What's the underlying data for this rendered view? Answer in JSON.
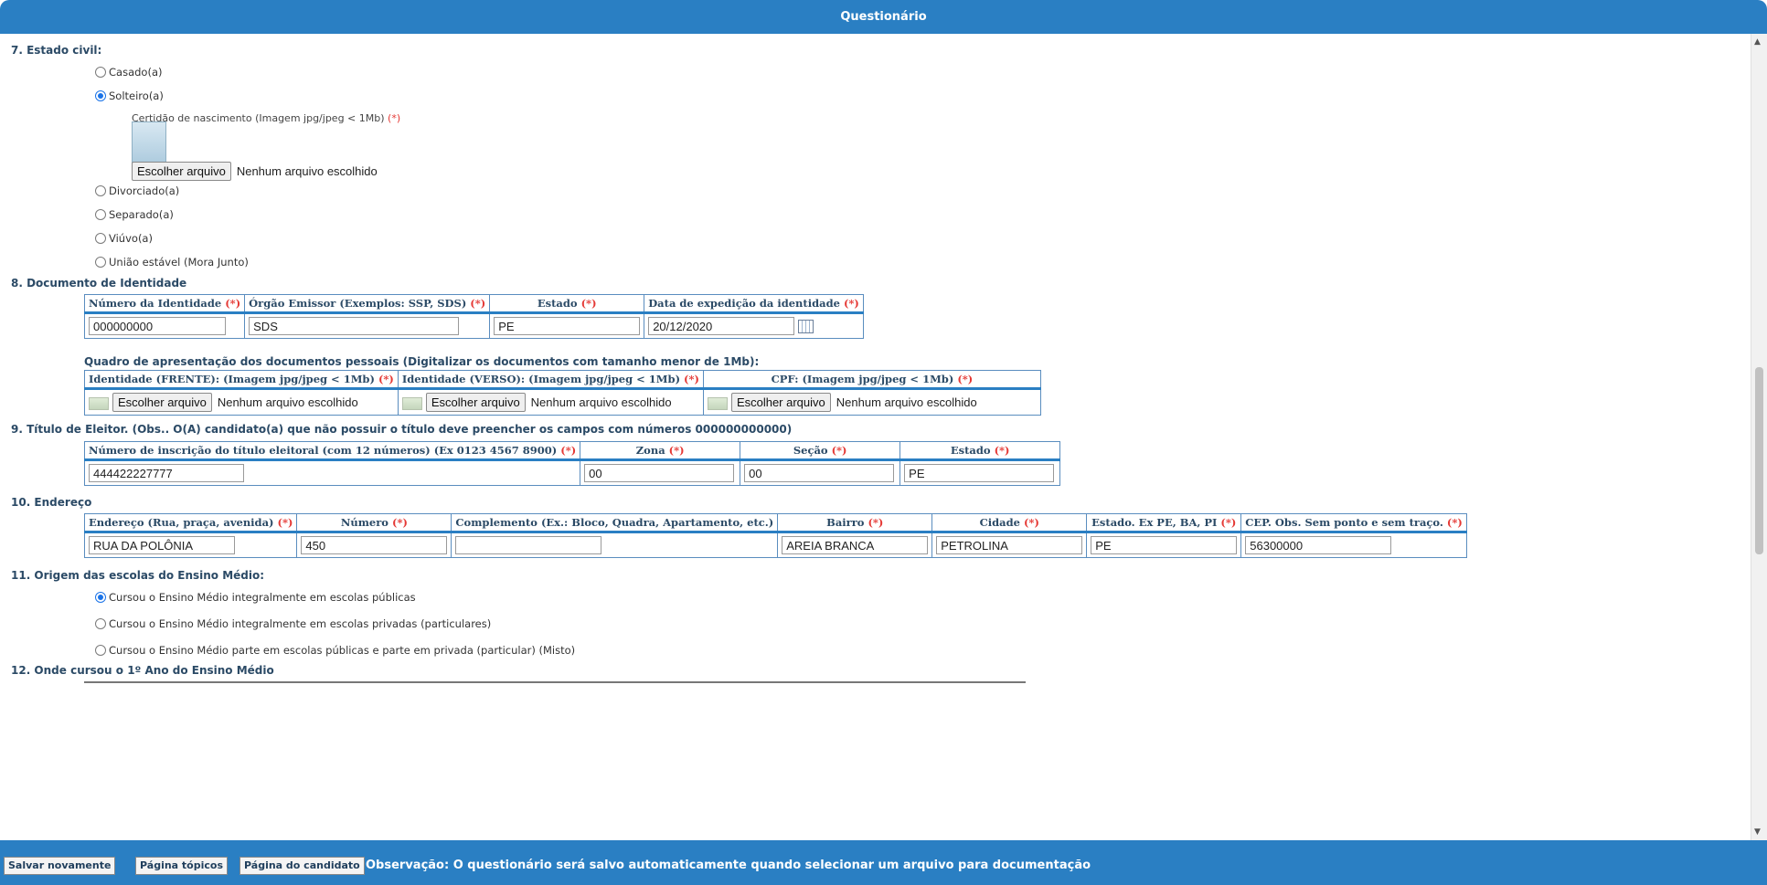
{
  "header": {
    "title": "Questionário"
  },
  "q7": {
    "title": "7. Estado civil:",
    "options": [
      "Casado(a)",
      "Solteiro(a)",
      "Divorciado(a)",
      "Separado(a)",
      "Viúvo(a)",
      "União estável (Mora Junto)"
    ],
    "selected": "Solteiro(a)",
    "attachment_label": "Certidão de nascimento (Imagem jpg/jpeg < 1Mb)",
    "required_mark": "(*)",
    "file_button": "Escolher arquivo",
    "file_status": "Nenhum arquivo escolhido"
  },
  "q8": {
    "title": "8. Documento de Identidade",
    "headers": [
      "Número da Identidade",
      "Órgão Emissor (Exemplos: SSP, SDS)",
      "Estado",
      "Data de expedição da identidade"
    ],
    "values": [
      "000000000",
      "SDS",
      "PE",
      "20/12/2020"
    ],
    "docs_caption": "Quadro de apresentação dos documentos pessoais (Digitalizar os documentos com tamanho menor de 1Mb):",
    "docs_headers": [
      "Identidade (FRENTE): (Imagem jpg/jpeg < 1Mb)",
      "Identidade (VERSO): (Imagem jpg/jpeg < 1Mb)",
      "CPF: (Imagem jpg/jpeg < 1Mb)"
    ]
  },
  "q9": {
    "title": "9. Título de Eleitor. (Obs.. O(A) candidato(a) que não possuir o título deve preencher os campos com números 000000000000)",
    "headers": [
      "Número de inscrição do título eleitoral (com 12 números) (Ex 0123 4567 8900)",
      "Zona",
      "Seção",
      "Estado"
    ],
    "values": [
      "444422227777",
      "00",
      "00",
      "PE"
    ]
  },
  "q10": {
    "title": "10. Endereço",
    "headers": [
      "Endereço (Rua, praça, avenida)",
      "Número",
      "Complemento (Ex.: Bloco, Quadra, Apartamento, etc.)",
      "Bairro",
      "Cidade",
      "Estado. Ex PE, BA, PI",
      "CEP. Obs. Sem ponto e sem traço."
    ],
    "values": [
      "RUA DA POLÔNIA",
      "450",
      "",
      "AREIA BRANCA",
      "PETROLINA",
      "PE",
      "56300000"
    ]
  },
  "q11": {
    "title": "11. Origem das escolas do Ensino Médio:",
    "options": [
      "Cursou o Ensino Médio integralmente em escolas públicas",
      "Cursou o Ensino Médio integralmente em escolas privadas (particulares)",
      "Cursou o Ensino Médio parte em escolas públicas e parte em privada (particular) (Misto)"
    ],
    "selected": "Cursou o Ensino Médio integralmente em escolas públicas"
  },
  "q12": {
    "title": "12. Onde cursou o 1º Ano do Ensino Médio"
  },
  "footer": {
    "buttons": [
      "Salvar novamente",
      "Página tópicos",
      "Página do candidato"
    ],
    "note": "Observação: O questionário será salvo automaticamente quando selecionar um arquivo para documentação"
  }
}
